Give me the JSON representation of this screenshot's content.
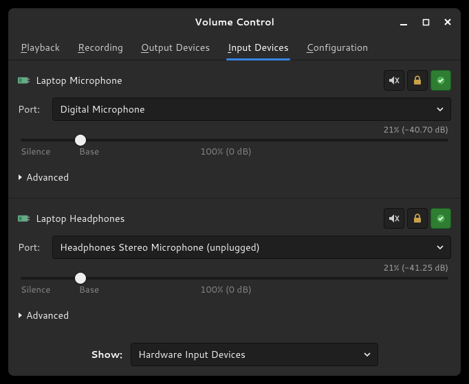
{
  "title": "Volume Control",
  "tabs": {
    "playback": "Playback",
    "recording": "Recording",
    "output": "Output Devices",
    "input": "Input Devices",
    "config": "Configuration"
  },
  "port_label": "Port:",
  "advanced_label": "Advanced",
  "ticks": {
    "silence": "Silence",
    "base": "Base",
    "hundred": "100% (0 dB)"
  },
  "devices": [
    {
      "name": "Laptop Microphone",
      "port": "Digital Microphone",
      "readout": "21% (-40.70 dB)",
      "thumb_pct": 14
    },
    {
      "name": "Laptop Headphones",
      "port": "Headphones Stereo Microphone (unplugged)",
      "readout": "21% (-41.25 dB)",
      "thumb_pct": 14
    }
  ],
  "footer": {
    "label": "Show:",
    "value": "Hardware Input Devices"
  }
}
